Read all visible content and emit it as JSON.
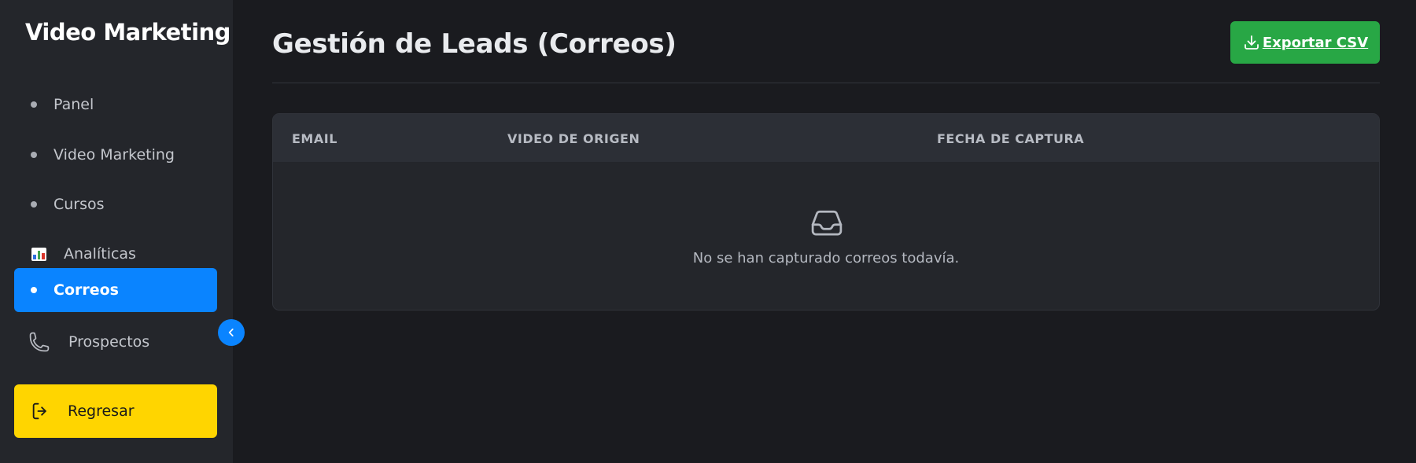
{
  "sidebar": {
    "brand": "Video Marketing",
    "items": [
      {
        "label": "Panel",
        "icon": "bullet-icon"
      },
      {
        "label": "Video Marketing",
        "icon": "bullet-icon"
      },
      {
        "label": "Cursos",
        "icon": "bullet-icon"
      },
      {
        "label": "Analíticas",
        "icon": "bar-chart-icon"
      },
      {
        "label": "Correos",
        "icon": "bullet-icon",
        "active": true
      },
      {
        "label": "Prospectos",
        "icon": "phone-icon"
      }
    ],
    "back_label": "Regresar",
    "collapse_icon": "chevron-left-icon"
  },
  "header": {
    "title": "Gestión de Leads (Correos)",
    "export_label": "Exportar CSV",
    "export_icon": "download-icon"
  },
  "table": {
    "columns": [
      "EMAIL",
      "VIDEO DE ORIGEN",
      "FECHA DE CAPTURA"
    ],
    "rows": [],
    "empty_message": "No se han capturado correos todavía.",
    "empty_icon": "inbox-icon"
  },
  "colors": {
    "accent": "#0a84ff",
    "export": "#28a745",
    "back": "#ffd500",
    "background": "#1a1b1f",
    "sidebar": "#24262b"
  }
}
